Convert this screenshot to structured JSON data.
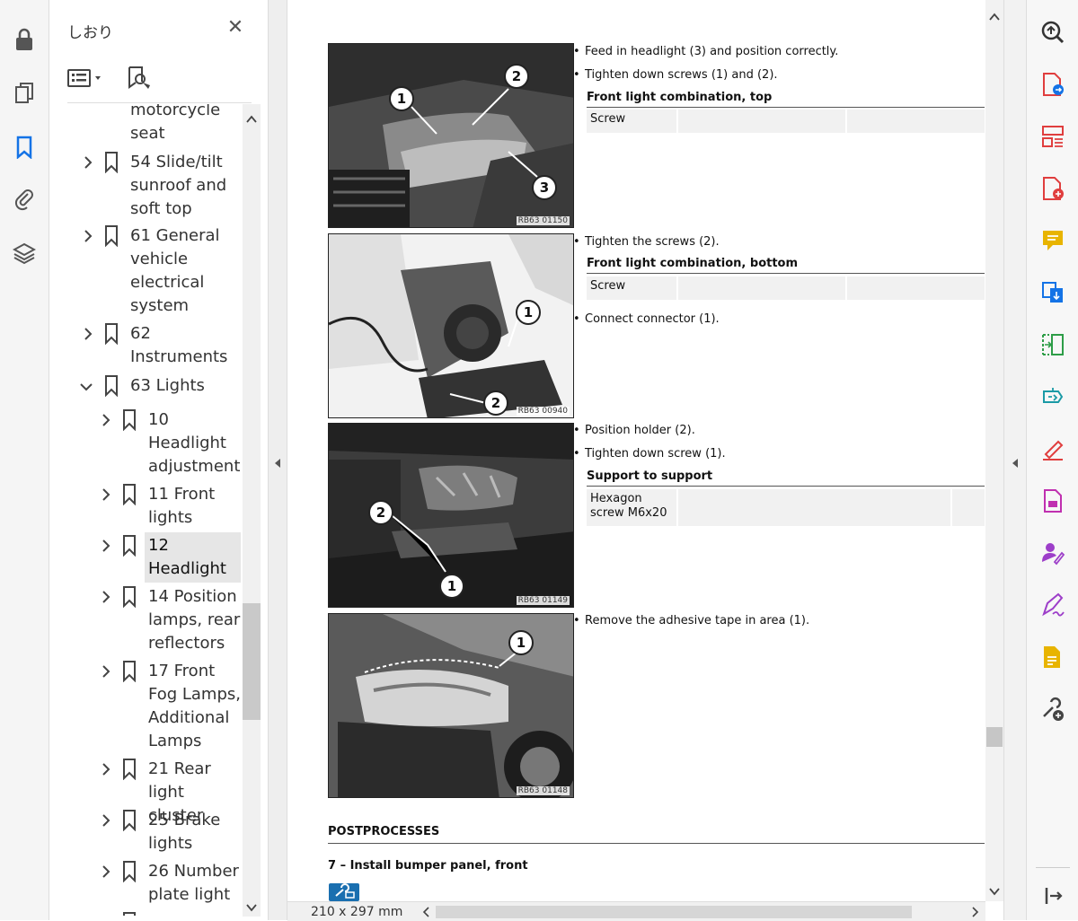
{
  "panel": {
    "title": "しおり",
    "close_symbol": "✕",
    "items": [
      {
        "label": "motorcycle\nseat"
      },
      {
        "label": "54 Slide/tilt\nsunroof and\nsoft top"
      },
      {
        "label": "61 General\nvehicle\nelectrical\nsystem"
      },
      {
        "label": "62\nInstruments"
      },
      {
        "label": "63 Lights"
      },
      {
        "label": "10\nHeadlight\nadjustment"
      },
      {
        "label": "11 Front\nlights"
      },
      {
        "label": "12\nHeadlight"
      },
      {
        "label": "14 Position\nlamps, rear\nreflectors"
      },
      {
        "label": "17 Front\nFog Lamps,\nAdditional\nLamps"
      },
      {
        "label": "21 Rear\nlight cluster"
      },
      {
        "label": "25 Brake\nlights"
      },
      {
        "label": "26 Number\nplate light"
      }
    ]
  },
  "doc": {
    "photos": [
      {
        "ref": "RB63 01150",
        "callouts": [
          "1",
          "2",
          "3"
        ]
      },
      {
        "ref": "RB63 00940",
        "callouts": [
          "1",
          "2"
        ]
      },
      {
        "ref": "RB63 01149",
        "callouts": [
          "2",
          "1"
        ]
      },
      {
        "ref": "RB63 01148",
        "callouts": [
          "1"
        ]
      }
    ],
    "step1": {
      "bullets": [
        "Feed in headlight (3) and position correctly.",
        "Tighten down screws (1) and (2)."
      ],
      "table_heading": "Front light combination, top",
      "cell": "Screw"
    },
    "step2": {
      "bullets": [
        "Tighten the screws (2).",
        "Connect connector (1)."
      ],
      "table_heading": "Front light combination, bottom",
      "cell": "Screw"
    },
    "step3": {
      "bullets": [
        "Position holder (2).",
        "Tighten down screw (1)."
      ],
      "table_heading": "Support to support",
      "cell": "Hexagon\nscrew M6x20"
    },
    "step4": {
      "bullets": [
        "Remove the adhesive tape in area (1)."
      ]
    },
    "postprocesses": "POSTPROCESSES",
    "next_step": "7 – Install bumper panel, front"
  },
  "status": {
    "page_size": "210 x 297 mm"
  },
  "colors": {
    "accent_blue": "#1473e6",
    "tool_red": "#e03e3e",
    "tool_yellow": "#e8b400",
    "tool_purple": "#9d3ec9",
    "tool_green": "#2d9d47",
    "tool_teal": "#1a9aa6"
  }
}
